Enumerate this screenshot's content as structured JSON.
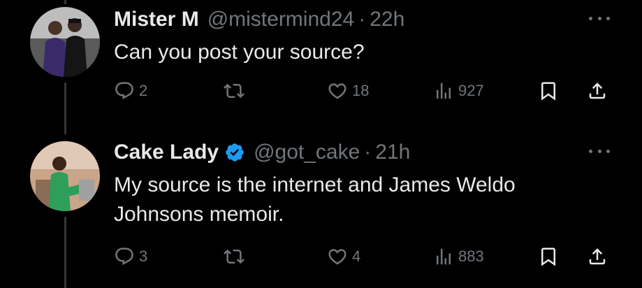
{
  "tweets": [
    {
      "display_name": "Mister M",
      "handle": "@mistermind24",
      "separator": "·",
      "time": "22h",
      "verified": false,
      "text": "Can you post your source?",
      "replies": "2",
      "reposts": "",
      "likes": "18",
      "views": "927"
    },
    {
      "display_name": "Cake Lady",
      "handle": "@got_cake",
      "separator": "·",
      "time": "21h",
      "verified": true,
      "text": "My source is the internet and James Weldo Johnsons memoir.",
      "replies": "3",
      "reposts": "",
      "likes": "4",
      "views": "883"
    }
  ],
  "icons": {
    "reply": "reply-icon",
    "repost": "repost-icon",
    "like": "like-icon",
    "views": "views-icon",
    "bookmark": "bookmark-icon",
    "share": "share-icon",
    "more": "more-icon",
    "verified": "verified-badge-icon"
  },
  "colors": {
    "background": "#000000",
    "text": "#e7e9ea",
    "secondary": "#71767b",
    "verified": "#1d9bf0",
    "thread_line": "#333639"
  }
}
